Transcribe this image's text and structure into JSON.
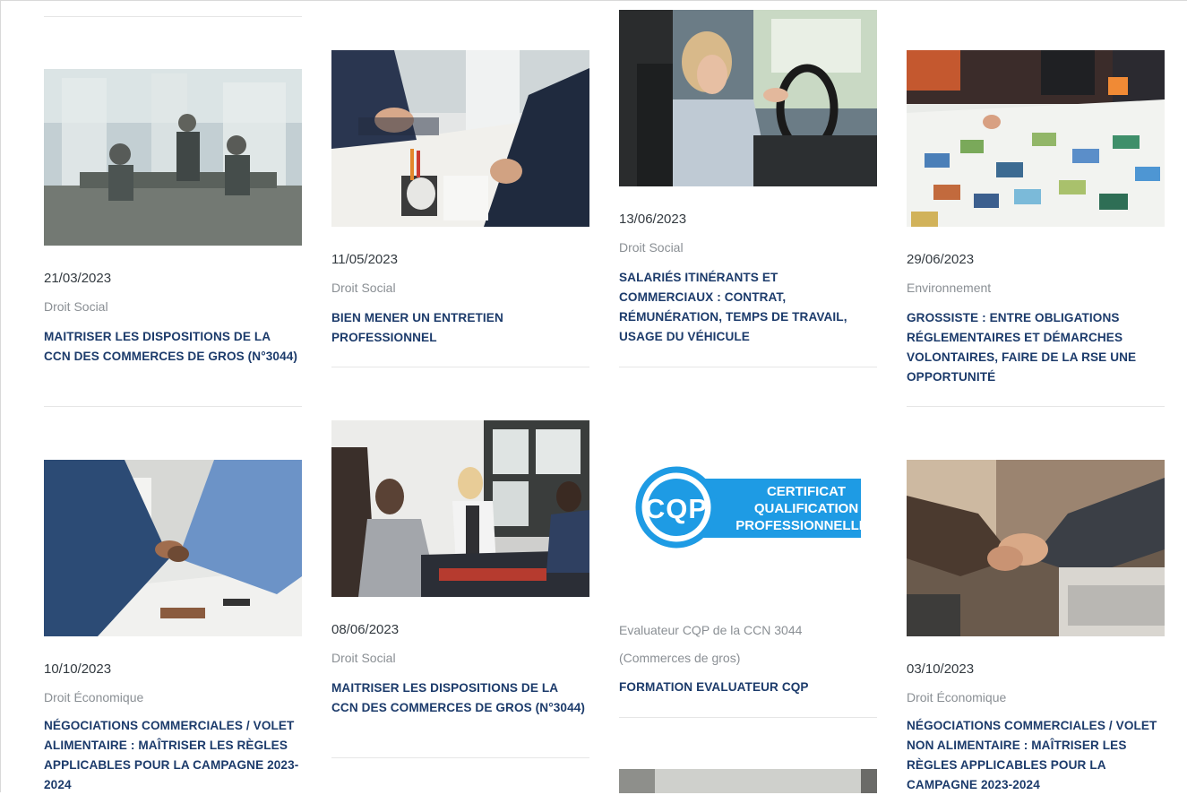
{
  "articles": [
    {
      "date": "21/03/2023",
      "category": "Droit Social",
      "title": "MAITRISER LES DISPOSITIONS DE LA CCN DES COMMERCES DE GROS (N°3044)"
    },
    {
      "date": "11/05/2023",
      "category": "Droit Social",
      "title": "BIEN MENER UN ENTRETIEN PROFESSIONNEL"
    },
    {
      "date": "13/06/2023",
      "category": "Droit Social",
      "title": "SALARIÉS ITINÉRANTS ET COMMERCIAUX : CONTRAT, RÉMUNÉRATION, TEMPS DE TRAVAIL, USAGE DU VÉHICULE"
    },
    {
      "date": "29/06/2023",
      "category": "Environnement",
      "title": "GROSSISTE : ENTRE OBLIGATIONS RÉGLEMENTAIRES ET DÉMARCHES VOLONTAIRES, FAIRE DE LA RSE UNE OPPORTUNITÉ"
    },
    {
      "date": "10/10/2023",
      "category": "Droit Économique",
      "title": "NÉGOCIATIONS COMMERCIALES / VOLET ALIMENTAIRE : MAÎTRISER LES RÈGLES APPLICABLES POUR LA CAMPAGNE 2023-2024"
    },
    {
      "date": "08/06/2023",
      "category": "Droit Social",
      "title": "MAITRISER LES DISPOSITIONS DE LA CCN DES COMMERCES DE GROS (N°3044)"
    },
    {
      "description_line1": "Evaluateur CQP de la CCN 3044",
      "description_line2": "(Commerces de gros)",
      "title": "FORMATION EVALUATEUR CQP"
    },
    {
      "date": "03/10/2023",
      "category": "Droit Économique",
      "title": "NÉGOCIATIONS COMMERCIALES / VOLET NON ALIMENTAIRE : MAÎTRISER LES RÈGLES APPLICABLES POUR LA CAMPAGNE 2023-2024"
    }
  ],
  "cqp_logo": {
    "abbr": "CQP",
    "line1": "CERTIFICAT",
    "line2": "QUALIFICATION",
    "line3": "PROFESSIONNELLE"
  },
  "colors": {
    "title": "#1c3b6b",
    "category": "#8a8f94",
    "date": "#333a40",
    "cqp_blue": "#1e9be4"
  }
}
